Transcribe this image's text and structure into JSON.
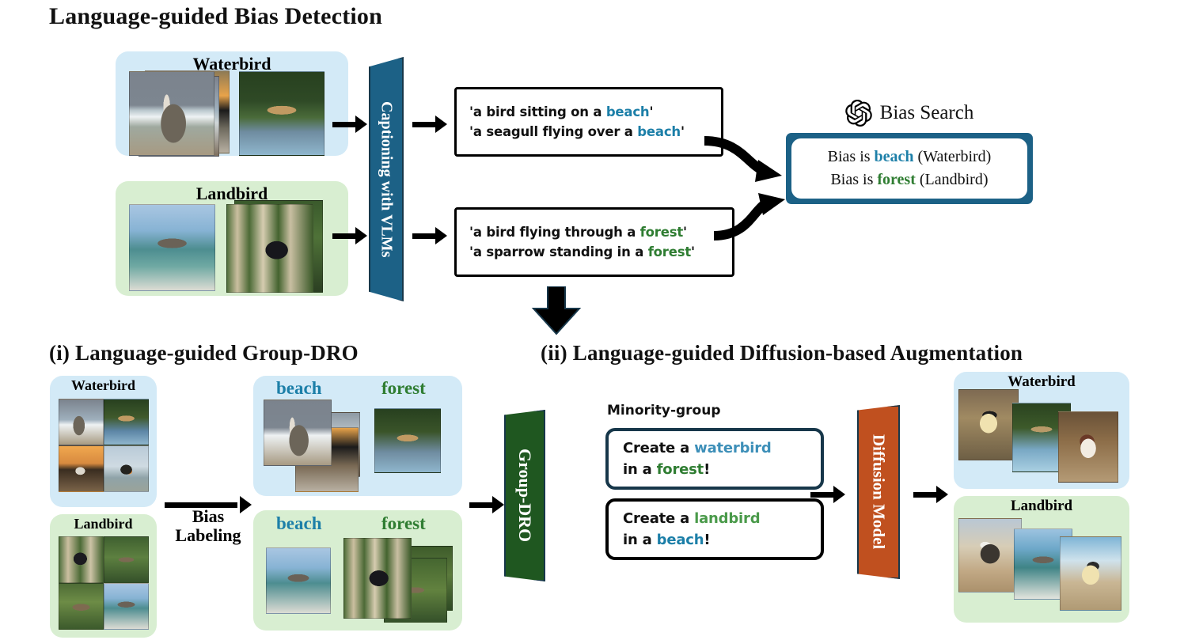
{
  "figure": {
    "main_title": "Language-guided Bias Detection",
    "section_i_title": "(i) Language-guided Group-DRO",
    "section_ii_title": "(ii) Language-guided Diffusion-based Augmentation"
  },
  "colors": {
    "teal": "#1c6186",
    "green": "#1f5720",
    "orange": "#c0501f",
    "panel_blue": "#d3eaf7",
    "panel_green": "#d8eed1",
    "beach_text": "#1c7fa8",
    "forest_text": "#2f7d32",
    "waterbird_text": "#3d8fb8",
    "landbird_text": "#4a9a4a"
  },
  "detection": {
    "waterbird_label": "Waterbird",
    "landbird_label": "Landbird",
    "captioner_label": "Captioning with VLMs",
    "captions_waterbird": [
      {
        "pre": "'a bird sitting on a ",
        "hl": "beach",
        "hl_class": "beach",
        "post": "'"
      },
      {
        "pre": "'a seagull flying over a ",
        "hl": "beach",
        "hl_class": "beach",
        "post": "'"
      }
    ],
    "captions_landbird": [
      {
        "pre": "'a bird flying through a ",
        "hl": "forest",
        "hl_class": "forest",
        "post": "'"
      },
      {
        "pre": "'a sparrow standing in a ",
        "hl": "forest",
        "hl_class": "forest",
        "post": "'"
      }
    ],
    "bias_search": {
      "icon": "openai-logo-icon",
      "title": "Bias Search",
      "results": [
        {
          "pre": "Bias is ",
          "hl": "beach",
          "hl_class": "beach",
          "post": " (Waterbird)"
        },
        {
          "pre": "Bias is ",
          "hl": "forest",
          "hl_class": "forest",
          "post": " (Landbird)"
        }
      ]
    }
  },
  "group_dro": {
    "input_waterbird_label": "Waterbird",
    "input_landbird_label": "Landbird",
    "bias_labeling_line1": "Bias",
    "bias_labeling_line2": "Labeling",
    "labeled_waterbird": {
      "left": "beach",
      "right": "forest"
    },
    "labeled_landbird": {
      "left": "beach",
      "right": "forest"
    },
    "model_label": "Group-DRO"
  },
  "augmentation": {
    "minority_group_label": "Minority-group",
    "prompts": [
      {
        "highlighted_box": true,
        "line1": {
          "pre": "Create a ",
          "hl": "waterbird",
          "hl_class": "wbird",
          "post": ""
        },
        "line2": {
          "pre": "in a ",
          "hl": "forest",
          "hl_class": "forest",
          "post": "!"
        }
      },
      {
        "highlighted_box": false,
        "line1": {
          "pre": "Create a ",
          "hl": "landbird",
          "hl_class": "lbird",
          "post": ""
        },
        "line2": {
          "pre": "in a ",
          "hl": "beach",
          "hl_class": "beach",
          "post": "!"
        }
      }
    ],
    "model_label": "Diffusion Model",
    "output_waterbird_label": "Waterbird",
    "output_landbird_label": "Landbird"
  }
}
